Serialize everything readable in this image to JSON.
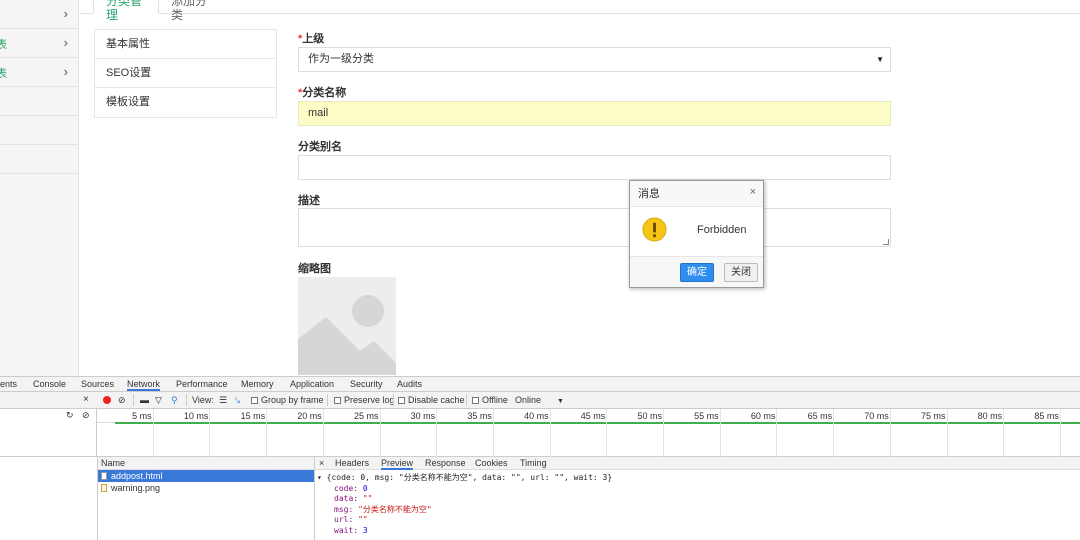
{
  "app": {
    "top_tabs": [
      {
        "label": "分类管理"
      },
      {
        "label": "添加分类"
      }
    ],
    "sidebar_items": [
      {
        "label": ""
      },
      {
        "label": "表"
      },
      {
        "label": "表"
      },
      {
        "label": "!"
      },
      {
        "label": "!"
      },
      {
        "label": "·"
      }
    ]
  },
  "form": {
    "subnav": [
      {
        "label": "基本属性"
      },
      {
        "label": "SEO设置"
      },
      {
        "label": "模板设置"
      }
    ],
    "parent_label": "上级",
    "parent_value": "作为一级分类",
    "name_label": "分类名称",
    "name_value": "mail",
    "alias_label": "分类别名",
    "desc_label": "描述",
    "thumb_label": "缩略图",
    "required_mark": "*"
  },
  "dialog": {
    "title": "消息",
    "close": "×",
    "message": "Forbidden",
    "ok_label": "确定",
    "cancel_label": "关闭"
  },
  "devtools": {
    "tabs": [
      "ents",
      "Console",
      "Sources",
      "Network",
      "Performance",
      "Memory",
      "Application",
      "Security",
      "Audits"
    ],
    "active_tab": "Network",
    "toolbar": {
      "view": "View:",
      "group_by_frame": "Group by frame",
      "preserve_log": "Preserve log",
      "disable_cache": "Disable cache",
      "offline": "Offline",
      "online": "Online"
    },
    "ticks": [
      "5 ms",
      "10 ms",
      "15 ms",
      "20 ms",
      "25 ms",
      "30 ms",
      "35 ms",
      "40 ms",
      "45 ms",
      "50 ms",
      "55 ms",
      "60 ms",
      "65 ms",
      "70 ms",
      "75 ms",
      "80 ms",
      "85 ms"
    ],
    "name_header": "Name",
    "requests": [
      "addpost.html",
      "warning.png"
    ],
    "detail_tabs": [
      "Headers",
      "Preview",
      "Response",
      "Cookies",
      "Timing"
    ],
    "detail_active": "Preview",
    "preview": {
      "summary": "▾ {code: 0, msg: \"分类名称不能为空\", data: \"\", url: \"\", wait: 3}",
      "code_key": "code:",
      "code_val": "0",
      "data_key": "data:",
      "data_val": "\"\"",
      "msg_key": "msg:",
      "msg_val": "\"分类名称不能为空\"",
      "url_key": "url:",
      "url_val": "\"\"",
      "wait_key": "wait:",
      "wait_val": "3"
    }
  },
  "colors": {
    "accent_green": "#2aa36b",
    "required_red": "#e4393c",
    "highlight_yellow": "#fbfcc6",
    "primary_blue": "#2e8ded",
    "devtools_blue": "#3879d9"
  }
}
